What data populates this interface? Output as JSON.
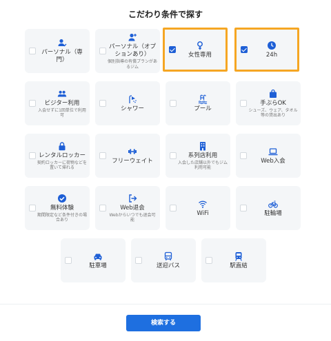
{
  "title": "こだわり条件で探す",
  "accent_color": "#1e5fd6",
  "highlight_color": "#f5a623",
  "items": [
    {
      "key": "personal-exclusive",
      "label": "パーソナル（専門）",
      "sub": "",
      "icon": "person-check-icon",
      "checked": false,
      "highlighted": false
    },
    {
      "key": "personal-option",
      "label": "パーソナル（オプションあり）",
      "sub": "個別指導の有償プランがあるジム",
      "icon": "person-add-icon",
      "checked": false,
      "highlighted": false
    },
    {
      "key": "women-only",
      "label": "女性専用",
      "sub": "",
      "icon": "female-icon",
      "checked": true,
      "highlighted": true
    },
    {
      "key": "24h",
      "label": "24h",
      "sub": "",
      "icon": "clock-icon",
      "checked": true,
      "highlighted": true
    },
    {
      "key": "visitor",
      "label": "ビジター利用",
      "sub": "入会せずに1回単位で利用可",
      "icon": "group-icon",
      "checked": false,
      "highlighted": false
    },
    {
      "key": "shower",
      "label": "シャワー",
      "sub": "",
      "icon": "shower-icon",
      "checked": false,
      "highlighted": false
    },
    {
      "key": "pool",
      "label": "プール",
      "sub": "",
      "icon": "pool-icon",
      "checked": false,
      "highlighted": false
    },
    {
      "key": "empty-handed",
      "label": "手ぶらOK",
      "sub": "シューズ、ウェア、タオル等の貸出あり",
      "icon": "bag-icon",
      "checked": false,
      "highlighted": false
    },
    {
      "key": "rental-locker",
      "label": "レンタルロッカー",
      "sub": "契約ロッカーに荷物などを置いて帰れる",
      "icon": "lock-icon",
      "checked": false,
      "highlighted": false
    },
    {
      "key": "free-weight",
      "label": "フリーウェイト",
      "sub": "",
      "icon": "dumbbell-icon",
      "checked": false,
      "highlighted": false
    },
    {
      "key": "affiliate",
      "label": "系列店利用",
      "sub": "入会した店舗以外でもジム利用可能",
      "icon": "building-icon",
      "checked": false,
      "highlighted": false
    },
    {
      "key": "web-join",
      "label": "Web入会",
      "sub": "",
      "icon": "laptop-icon",
      "checked": false,
      "highlighted": false
    },
    {
      "key": "free-trial",
      "label": "無料体験",
      "sub": "期間限定など条件付きの場合あり",
      "icon": "check-circle-icon",
      "checked": false,
      "highlighted": false
    },
    {
      "key": "web-cancel",
      "label": "Web退会",
      "sub": "Webからいつでも退会可能",
      "icon": "logout-icon",
      "checked": false,
      "highlighted": false
    },
    {
      "key": "wifi",
      "label": "WiFi",
      "sub": "",
      "icon": "wifi-icon",
      "checked": false,
      "highlighted": false
    },
    {
      "key": "bike-parking",
      "label": "駐輪場",
      "sub": "",
      "icon": "bicycle-icon",
      "checked": false,
      "highlighted": false
    },
    {
      "key": "parking",
      "label": "駐車場",
      "sub": "",
      "icon": "car-icon",
      "checked": false,
      "highlighted": false
    },
    {
      "key": "shuttle",
      "label": "送迎バス",
      "sub": "",
      "icon": "bus-icon",
      "checked": false,
      "highlighted": false
    },
    {
      "key": "station",
      "label": "駅直結",
      "sub": "",
      "icon": "train-icon",
      "checked": false,
      "highlighted": false
    }
  ],
  "search_button": "検索する"
}
